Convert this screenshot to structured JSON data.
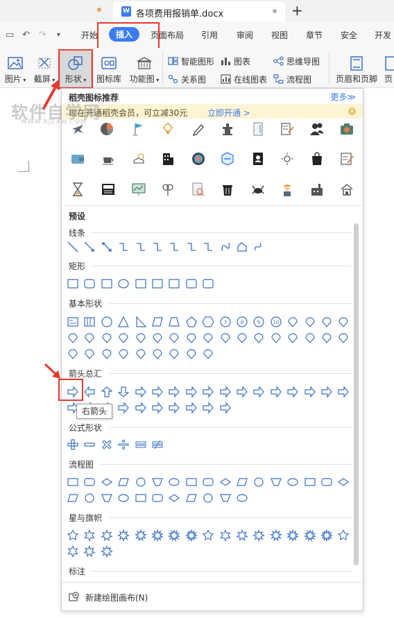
{
  "titlebar": {
    "doc_title": "各项费用报销单.docx",
    "new_tab": "+"
  },
  "menubar": {
    "tabs": [
      "开始",
      "插入",
      "页面布局",
      "引用",
      "审阅",
      "视图",
      "章节",
      "安全",
      "开发"
    ],
    "active_tab": "插入"
  },
  "ribbon": {
    "picture": "图片",
    "screenshot": "截屏",
    "shape": "形状",
    "icon_lib": "图标库",
    "func_chart": "功能图",
    "smart_shape": "智能图形",
    "chart": "图表",
    "mindmap": "思维导图",
    "relation": "关系图",
    "online_chart": "在线图表",
    "flowchart": "流程图",
    "header_footer": "页眉和页脚",
    "page_num": "页"
  },
  "panel": {
    "icons_title": "稻壳图标推荐",
    "more": "更多≫",
    "promo_text": "现在开通稻壳会员，可立减30元",
    "promo_link": "立即开通 >",
    "preset": "预设",
    "sections": [
      "线条",
      "矩形",
      "基本形状",
      "箭头总汇",
      "公式形状",
      "流程图",
      "星与旗帜",
      "标注"
    ],
    "tooltip": "右箭头",
    "new_canvas": "新建绘图画布(N)"
  },
  "watermark": {
    "main": "软件自学网",
    "sub": "WWW.RJZXW.COM"
  },
  "colors": {
    "accent": "#3b7cf0",
    "annotation_red": "#e8382f",
    "shape_stroke": "#3a6fc4"
  }
}
